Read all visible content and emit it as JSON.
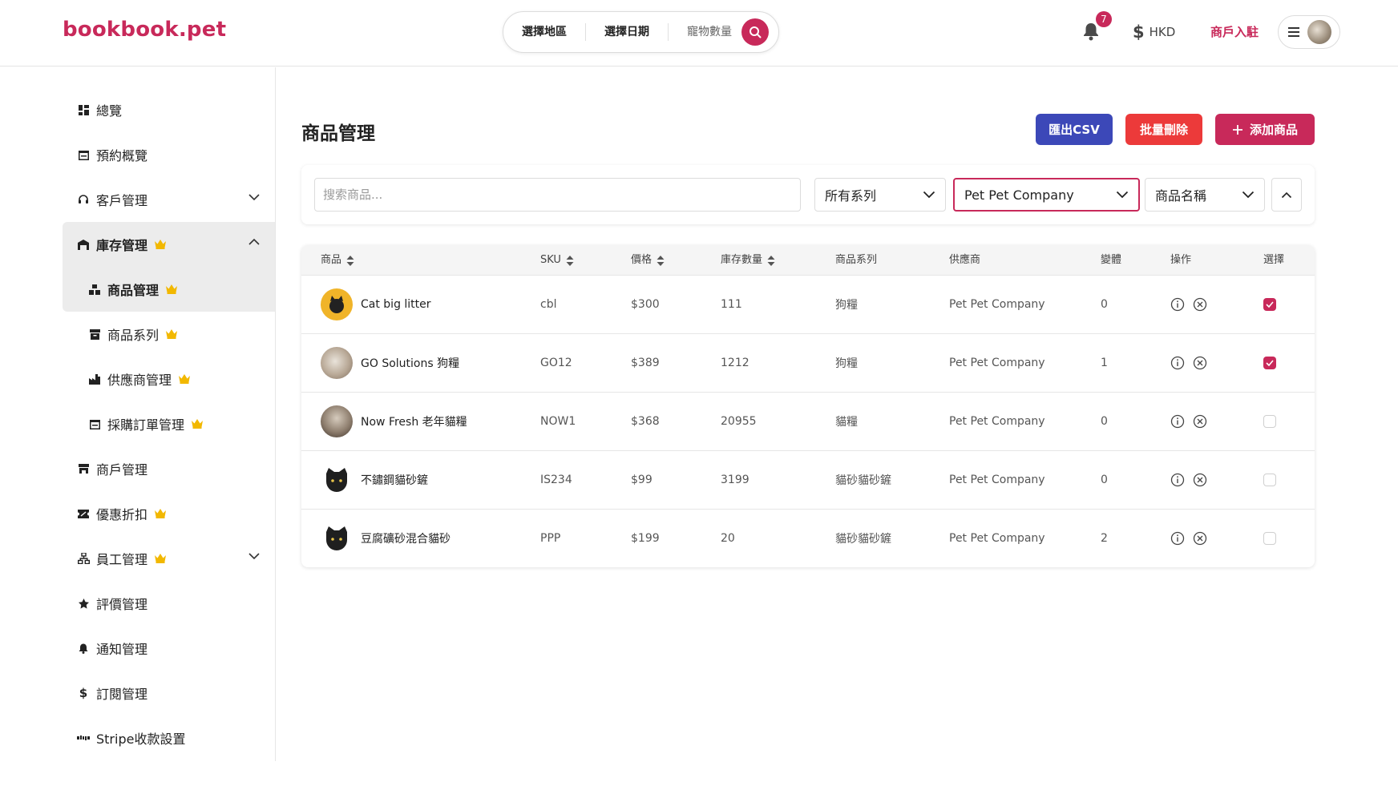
{
  "brand": {
    "logo_text": "bookbook.pet",
    "accent": "#c8295a"
  },
  "search": {
    "area_label": "選擇地區",
    "date_label": "選擇日期",
    "pets_label": "寵物數量"
  },
  "header": {
    "notifications_count": "7",
    "currency": "HKD",
    "merchant_link": "商戶入駐"
  },
  "sidebar": {
    "items": [
      {
        "label": "總覽",
        "icon": "dashboard-icon"
      },
      {
        "label": "預約概覽",
        "icon": "calendar-icon"
      },
      {
        "label": "客戶管理",
        "icon": "headset-icon"
      },
      {
        "label": "庫存管理",
        "icon": "warehouse-icon"
      },
      {
        "label": "商品管理",
        "icon": "boxes-icon"
      },
      {
        "label": "商品系列",
        "icon": "archive-icon"
      },
      {
        "label": "供應商管理",
        "icon": "factory-icon"
      },
      {
        "label": "採購訂單管理",
        "icon": "calendar-icon"
      },
      {
        "label": "商戶管理",
        "icon": "store-icon"
      },
      {
        "label": "優惠折扣",
        "icon": "ticket-icon"
      },
      {
        "label": "員工管理",
        "icon": "org-icon"
      },
      {
        "label": "評價管理",
        "icon": "star-icon"
      },
      {
        "label": "通知管理",
        "icon": "bell-icon"
      },
      {
        "label": "訂閱管理",
        "icon": "dollar-icon"
      },
      {
        "label": "Stripe收款設置",
        "icon": "stripe-icon"
      }
    ]
  },
  "page": {
    "title": "商品管理",
    "export_label": "匯出CSV",
    "bulk_delete_label": "批量刪除",
    "add_label": "添加商品"
  },
  "filters": {
    "search_placeholder": "搜索商品...",
    "series_value": "所有系列",
    "supplier_value": "Pet Pet Company",
    "sort_value": "商品名稱"
  },
  "table": {
    "headers": {
      "product": "商品",
      "sku": "SKU",
      "price": "價格",
      "stock": "庫存數量",
      "series": "商品系列",
      "supplier": "供應商",
      "variants": "變體",
      "actions": "操作",
      "select": "選擇"
    },
    "rows": [
      {
        "name": "Cat big litter",
        "sku": "cbl",
        "price": "$300",
        "stock": "111",
        "series": "狗糧",
        "supplier": "Pet Pet Company",
        "variants": "0",
        "selected": true
      },
      {
        "name": "GO Solutions 狗糧",
        "sku": "GO12",
        "price": "$389",
        "stock": "1212",
        "series": "狗糧",
        "supplier": "Pet Pet Company",
        "variants": "1",
        "selected": true
      },
      {
        "name": "Now Fresh 老年貓糧",
        "sku": "NOW1",
        "price": "$368",
        "stock": "20955",
        "series": "貓糧",
        "supplier": "Pet Pet Company",
        "variants": "0",
        "selected": false
      },
      {
        "name": "不鏽鋼貓砂鏟",
        "sku": "IS234",
        "price": "$99",
        "stock": "3199",
        "series": "貓砂貓砂鏟",
        "supplier": "Pet Pet Company",
        "variants": "0",
        "selected": false
      },
      {
        "name": "豆腐礦砂混合貓砂",
        "sku": "PPP",
        "price": "$199",
        "stock": "20",
        "series": "貓砂貓砂鏟",
        "supplier": "Pet Pet Company",
        "variants": "2",
        "selected": false
      }
    ]
  }
}
